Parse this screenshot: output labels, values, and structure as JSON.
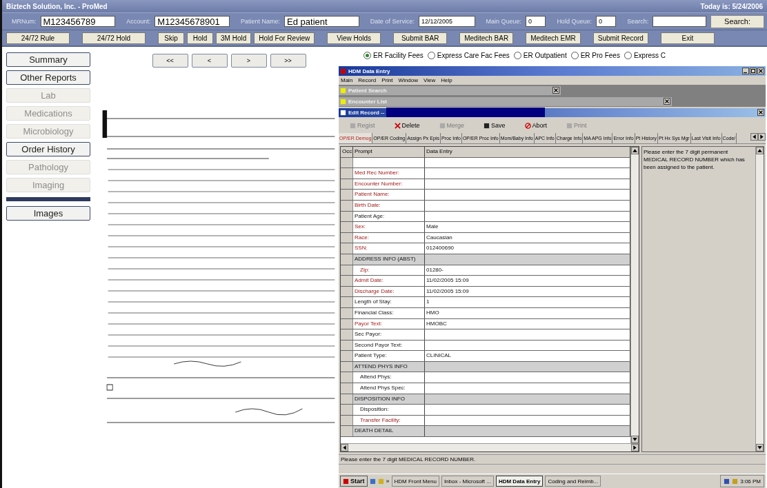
{
  "window": {
    "title": "Biztech Solution, Inc. - ProMed",
    "date": "Today is: 5/24/2006"
  },
  "header_fields": [
    {
      "label": "MRNum:",
      "value": "M123456789",
      "kind": "big"
    },
    {
      "label": "Account:",
      "value": "M12345678901",
      "kind": "big"
    },
    {
      "label": "Patient Name:",
      "value": "Ed patient",
      "kind": "big"
    },
    {
      "label": "Date of Service:",
      "value": "12/12/2005",
      "kind": "small"
    },
    {
      "label": "Main Queue:",
      "value": "0",
      "kind": "tiny"
    },
    {
      "label": "Hold Queue:",
      "value": "0",
      "kind": "tiny"
    },
    {
      "label": "Search:",
      "kind": "search"
    }
  ],
  "search_button": "Search:",
  "action_buttons": [
    "24/72 Rule",
    "24/72 Hold",
    "Skip",
    "Hold",
    "3M Hold",
    "Hold For Review",
    "View Holds",
    "Submit BAR",
    "Meditech BAR",
    "Meditech EMR",
    "Submit Record",
    "Exit"
  ],
  "sidebar": {
    "items": [
      {
        "label": "Summary",
        "disabled": false
      },
      {
        "label": "Other Reports",
        "disabled": false
      },
      {
        "label": "Lab",
        "disabled": true
      },
      {
        "label": "Medications",
        "disabled": true
      },
      {
        "label": "Microbiology",
        "disabled": true
      },
      {
        "label": "Order History",
        "disabled": false
      },
      {
        "label": "Pathology",
        "disabled": true
      },
      {
        "label": "Imaging",
        "disabled": true
      }
    ],
    "bottom_items": [
      {
        "label": "Images",
        "disabled": false
      }
    ]
  },
  "page_nav": [
    "<<",
    "<",
    ">",
    ">>"
  ],
  "fee_types": [
    {
      "label": "ER Facility Fees",
      "selected": true
    },
    {
      "label": "Express Care Fac Fees",
      "selected": false
    },
    {
      "label": "ER Outpatient",
      "selected": false
    },
    {
      "label": "ER Pro Fees",
      "selected": false
    },
    {
      "label": "Express C",
      "selected": false
    }
  ],
  "hdm": {
    "title": "HDM Data Entry",
    "menu": [
      "Main",
      "Record",
      "Print",
      "Window",
      "View",
      "Help"
    ],
    "child_windows": [
      {
        "title": "Patient Search",
        "kind": "minimized"
      },
      {
        "title": "Encounter List",
        "kind": "minimized"
      },
      {
        "title": "Edit Record --",
        "kind": "active"
      }
    ],
    "toolbar": [
      {
        "label": "Regist",
        "disabled": true
      },
      {
        "label": "Delete",
        "disabled": false
      },
      {
        "label": "Merge",
        "disabled": true
      },
      {
        "label": "Save",
        "disabled": false
      },
      {
        "label": "Abort",
        "disabled": false
      },
      {
        "label": "Print",
        "disabled": true
      }
    ],
    "tabs": [
      {
        "label": "OP/ER Demog",
        "selected": true
      },
      {
        "label": "OP/ER Coding",
        "selected": false
      },
      {
        "label": "Assign Px Epis",
        "selected": false
      },
      {
        "label": "Proc Info",
        "selected": false
      },
      {
        "label": "OP/ER Proc Info",
        "selected": false
      },
      {
        "label": "Mom/Baby Info",
        "selected": false
      },
      {
        "label": "APC Info",
        "selected": false
      },
      {
        "label": "Charge Info",
        "selected": false
      },
      {
        "label": "MA APG Info",
        "selected": false
      },
      {
        "label": "Error Info",
        "selected": false
      },
      {
        "label": "Pt History",
        "selected": false
      },
      {
        "label": "Pt Hx Sys Mgr",
        "selected": false
      },
      {
        "label": "Last Visit Info",
        "selected": false
      },
      {
        "label": "Code/",
        "selected": false
      }
    ],
    "columns": [
      "Occ",
      "Prompt",
      "Data Entry"
    ],
    "rows": [
      {
        "prompt": "Med Rec Number:",
        "kind": "field",
        "required": true
      },
      {
        "prompt": "Encounter Number:",
        "kind": "field",
        "required": true
      },
      {
        "prompt": "Patient Name:",
        "kind": "field",
        "required": true
      },
      {
        "prompt": "Birth Date:",
        "kind": "field",
        "required": true
      },
      {
        "prompt": "Patient Age:",
        "kind": "field",
        "required": false
      },
      {
        "prompt": "Sex:",
        "value": "Male",
        "kind": "field",
        "required": true
      },
      {
        "prompt": "Race:",
        "value": "Caucasian",
        "kind": "field",
        "required": true
      },
      {
        "prompt": "SSN:",
        "value": "012400690",
        "kind": "field",
        "required": true
      },
      {
        "prompt": "ADDRESS INFO (ABST)",
        "kind": "section",
        "required": false,
        "children": [
          {
            "prompt": "Zip:",
            "value": "01280-",
            "kind": "field",
            "required": true
          }
        ]
      },
      {
        "prompt": "Admit Date:",
        "value": "11/02/2005 15:09",
        "kind": "field",
        "required": true
      },
      {
        "prompt": "Discharge Date:",
        "value": "11/02/2005 15:09",
        "kind": "field",
        "required": true
      },
      {
        "prompt": "Length of Stay:",
        "value": "1",
        "kind": "field",
        "required": false
      },
      {
        "prompt": "Financial Class:",
        "value": "HMO",
        "kind": "field",
        "required": false
      },
      {
        "prompt": "Payor Text:",
        "value": "HMOBC",
        "kind": "field",
        "required": true
      },
      {
        "prompt": "Sec Payor:",
        "kind": "field",
        "required": false
      },
      {
        "prompt": "Second Payor Text:",
        "kind": "field",
        "required": false
      },
      {
        "prompt": "Patient Type:",
        "value": "CLINICAL",
        "kind": "field",
        "required": false
      },
      {
        "prompt": "ATTEND PHYS INFO",
        "kind": "section",
        "required": false,
        "children": [
          {
            "prompt": "Attend Phys:",
            "kind": "field",
            "required": false
          },
          {
            "prompt": "Attend Phys Spec:",
            "kind": "field",
            "required": false
          }
        ]
      },
      {
        "prompt": "DISPOSITION INFO",
        "kind": "section",
        "required": false,
        "children": [
          {
            "prompt": "Disposition:",
            "kind": "field",
            "required": false
          },
          {
            "prompt": "Transfer Facility:",
            "kind": "field",
            "required": true
          }
        ]
      },
      {
        "prompt": "DEATH DETAIL",
        "kind": "section",
        "required": false
      }
    ],
    "hint": "Please enter the 7 digit permanent MEDICAL RECORD NUMBER which has been assigned to the patient.",
    "status": "Please enter the 7 digit MEDICAL RECORD NUMBER."
  },
  "taskbar": {
    "start": "Start",
    "overflow": "»",
    "tasks": [
      {
        "label": "HDM Front Menu",
        "selected": false
      },
      {
        "label": "Inbox - Microsoft ...",
        "selected": false
      },
      {
        "label": "HDM Data Entry",
        "selected": true
      },
      {
        "label": "Coding and Reimb...",
        "selected": false
      }
    ],
    "clock": "3:06 PM"
  }
}
